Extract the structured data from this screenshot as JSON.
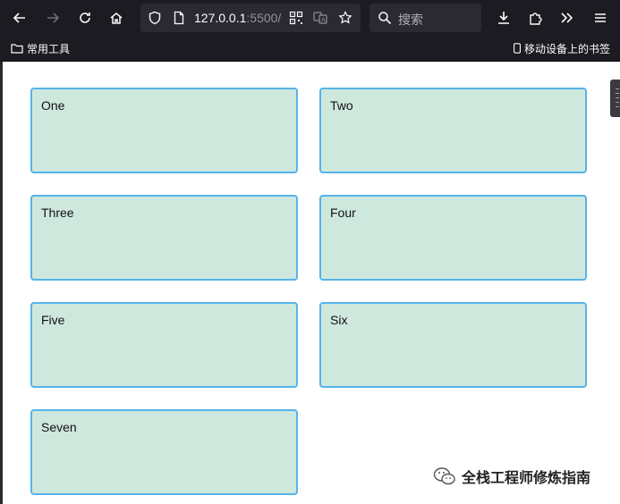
{
  "browser": {
    "url_host": "127.0.0.1",
    "url_port": ":5500/",
    "search_placeholder": "搜索",
    "bookmarks": {
      "left_label": "常用工具",
      "right_label": "移动设备上的书签"
    }
  },
  "cards": [
    "One",
    "Two",
    "Three",
    "Four",
    "Five",
    "Six",
    "Seven"
  ],
  "watermark": {
    "text": "全栈工程师修炼指南"
  },
  "colors": {
    "card_bg": "#cfe8dd",
    "card_border": "#56b4e9",
    "chrome_bg": "#1c1b22"
  }
}
